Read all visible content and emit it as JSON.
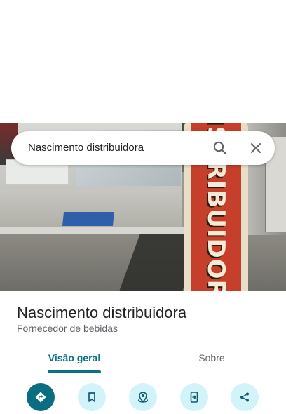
{
  "search": {
    "query": "Nascimento distribuidora"
  },
  "photo": {
    "sign_text": "DISTRIBUIDORA"
  },
  "place": {
    "name": "Nascimento distribuidora",
    "category": "Fornecedor de bebidas"
  },
  "tabs": [
    {
      "label": "Visão geral",
      "selected": true
    },
    {
      "label": "Sobre",
      "selected": false
    }
  ],
  "actions": [
    {
      "icon": "directions-icon"
    },
    {
      "icon": "bookmark-icon"
    },
    {
      "icon": "nearby-icon"
    },
    {
      "icon": "send-to-phone-icon"
    },
    {
      "icon": "share-icon"
    }
  ],
  "colors": {
    "accent": "#0b7285",
    "primary_action": "#0b6e80",
    "secondary_action_bg": "#d3f3fb",
    "tab_inactive": "#5f6368"
  }
}
